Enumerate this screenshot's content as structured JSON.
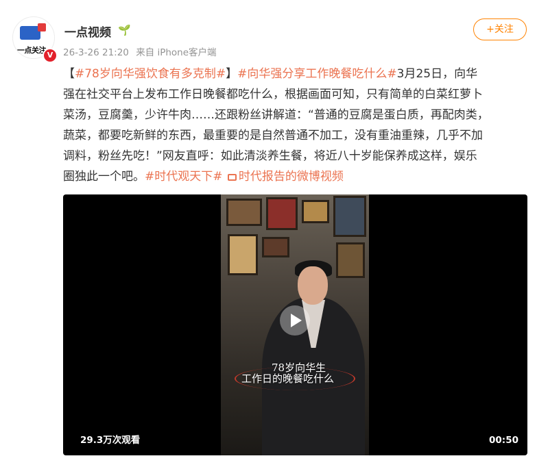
{
  "post": {
    "author": "一点视频",
    "author_badge_icon": "sprout-icon",
    "timestamp": "26-3-26 21:20",
    "source": "来自 iPhone客户端",
    "follow_label": "+关注",
    "avatar": {
      "text": "一点关注",
      "badge": "V"
    },
    "lines": [
      {
        "parts": [
          {
            "text": "【",
            "topic": false
          },
          {
            "text": "#78岁向华强饮食有多克制#",
            "topic": true
          },
          {
            "text": "】",
            "topic": false
          },
          {
            "text": "#向华强分享工作晚餐吃什么#",
            "topic": true
          },
          {
            "text": "3月25日，向华",
            "topic": false
          }
        ]
      },
      {
        "parts": [
          {
            "text": "强在社交平台上发布工作日晚餐都吃什么，根据画面可知，只有简单的白菜红萝卜",
            "topic": false
          }
        ]
      },
      {
        "parts": [
          {
            "text": "菜汤，豆腐羹，少许牛肉……还跟粉丝讲解道：“普通的豆腐是蛋白质，再配肉类，",
            "topic": false
          }
        ]
      },
      {
        "parts": [
          {
            "text": "蔬菜，都要吃新鲜的东西，最重要的是自然普通不加工，没有重油重辣，几乎不加",
            "topic": false
          }
        ]
      },
      {
        "parts": [
          {
            "text": "调料，粉丝先吃！”网友直呼：如此清淡养生餐，将近八十岁能保养成这样，娱乐",
            "topic": false
          }
        ]
      },
      {
        "parts": [
          {
            "text": "圈独此一个吧。",
            "topic": false
          },
          {
            "text": "#时代观天下#",
            "topic": true
          }
        ]
      }
    ],
    "video_link": {
      "icon": "video-camera-icon",
      "label": "时代报告的微博视频"
    },
    "video": {
      "caption_line1": "78岁向华生",
      "caption_line2": "工作日的晚餐吃什么",
      "views": "29.3万次观看",
      "duration": "00:50",
      "play_icon": "play-icon"
    },
    "colors": {
      "topic": "#eb7350",
      "follow": "#ff8200",
      "meta": "#939393",
      "badge": "#e2212b"
    }
  }
}
